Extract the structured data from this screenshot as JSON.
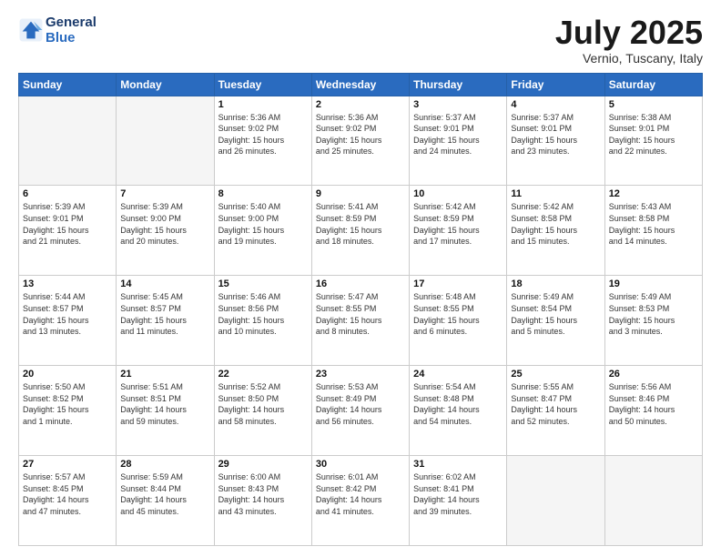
{
  "header": {
    "logo_line1": "General",
    "logo_line2": "Blue",
    "month_year": "July 2025",
    "location": "Vernio, Tuscany, Italy"
  },
  "days_of_week": [
    "Sunday",
    "Monday",
    "Tuesday",
    "Wednesday",
    "Thursday",
    "Friday",
    "Saturday"
  ],
  "weeks": [
    [
      {
        "day": "",
        "info": ""
      },
      {
        "day": "",
        "info": ""
      },
      {
        "day": "1",
        "info": "Sunrise: 5:36 AM\nSunset: 9:02 PM\nDaylight: 15 hours\nand 26 minutes."
      },
      {
        "day": "2",
        "info": "Sunrise: 5:36 AM\nSunset: 9:02 PM\nDaylight: 15 hours\nand 25 minutes."
      },
      {
        "day": "3",
        "info": "Sunrise: 5:37 AM\nSunset: 9:01 PM\nDaylight: 15 hours\nand 24 minutes."
      },
      {
        "day": "4",
        "info": "Sunrise: 5:37 AM\nSunset: 9:01 PM\nDaylight: 15 hours\nand 23 minutes."
      },
      {
        "day": "5",
        "info": "Sunrise: 5:38 AM\nSunset: 9:01 PM\nDaylight: 15 hours\nand 22 minutes."
      }
    ],
    [
      {
        "day": "6",
        "info": "Sunrise: 5:39 AM\nSunset: 9:01 PM\nDaylight: 15 hours\nand 21 minutes."
      },
      {
        "day": "7",
        "info": "Sunrise: 5:39 AM\nSunset: 9:00 PM\nDaylight: 15 hours\nand 20 minutes."
      },
      {
        "day": "8",
        "info": "Sunrise: 5:40 AM\nSunset: 9:00 PM\nDaylight: 15 hours\nand 19 minutes."
      },
      {
        "day": "9",
        "info": "Sunrise: 5:41 AM\nSunset: 8:59 PM\nDaylight: 15 hours\nand 18 minutes."
      },
      {
        "day": "10",
        "info": "Sunrise: 5:42 AM\nSunset: 8:59 PM\nDaylight: 15 hours\nand 17 minutes."
      },
      {
        "day": "11",
        "info": "Sunrise: 5:42 AM\nSunset: 8:58 PM\nDaylight: 15 hours\nand 15 minutes."
      },
      {
        "day": "12",
        "info": "Sunrise: 5:43 AM\nSunset: 8:58 PM\nDaylight: 15 hours\nand 14 minutes."
      }
    ],
    [
      {
        "day": "13",
        "info": "Sunrise: 5:44 AM\nSunset: 8:57 PM\nDaylight: 15 hours\nand 13 minutes."
      },
      {
        "day": "14",
        "info": "Sunrise: 5:45 AM\nSunset: 8:57 PM\nDaylight: 15 hours\nand 11 minutes."
      },
      {
        "day": "15",
        "info": "Sunrise: 5:46 AM\nSunset: 8:56 PM\nDaylight: 15 hours\nand 10 minutes."
      },
      {
        "day": "16",
        "info": "Sunrise: 5:47 AM\nSunset: 8:55 PM\nDaylight: 15 hours\nand 8 minutes."
      },
      {
        "day": "17",
        "info": "Sunrise: 5:48 AM\nSunset: 8:55 PM\nDaylight: 15 hours\nand 6 minutes."
      },
      {
        "day": "18",
        "info": "Sunrise: 5:49 AM\nSunset: 8:54 PM\nDaylight: 15 hours\nand 5 minutes."
      },
      {
        "day": "19",
        "info": "Sunrise: 5:49 AM\nSunset: 8:53 PM\nDaylight: 15 hours\nand 3 minutes."
      }
    ],
    [
      {
        "day": "20",
        "info": "Sunrise: 5:50 AM\nSunset: 8:52 PM\nDaylight: 15 hours\nand 1 minute."
      },
      {
        "day": "21",
        "info": "Sunrise: 5:51 AM\nSunset: 8:51 PM\nDaylight: 14 hours\nand 59 minutes."
      },
      {
        "day": "22",
        "info": "Sunrise: 5:52 AM\nSunset: 8:50 PM\nDaylight: 14 hours\nand 58 minutes."
      },
      {
        "day": "23",
        "info": "Sunrise: 5:53 AM\nSunset: 8:49 PM\nDaylight: 14 hours\nand 56 minutes."
      },
      {
        "day": "24",
        "info": "Sunrise: 5:54 AM\nSunset: 8:48 PM\nDaylight: 14 hours\nand 54 minutes."
      },
      {
        "day": "25",
        "info": "Sunrise: 5:55 AM\nSunset: 8:47 PM\nDaylight: 14 hours\nand 52 minutes."
      },
      {
        "day": "26",
        "info": "Sunrise: 5:56 AM\nSunset: 8:46 PM\nDaylight: 14 hours\nand 50 minutes."
      }
    ],
    [
      {
        "day": "27",
        "info": "Sunrise: 5:57 AM\nSunset: 8:45 PM\nDaylight: 14 hours\nand 47 minutes."
      },
      {
        "day": "28",
        "info": "Sunrise: 5:59 AM\nSunset: 8:44 PM\nDaylight: 14 hours\nand 45 minutes."
      },
      {
        "day": "29",
        "info": "Sunrise: 6:00 AM\nSunset: 8:43 PM\nDaylight: 14 hours\nand 43 minutes."
      },
      {
        "day": "30",
        "info": "Sunrise: 6:01 AM\nSunset: 8:42 PM\nDaylight: 14 hours\nand 41 minutes."
      },
      {
        "day": "31",
        "info": "Sunrise: 6:02 AM\nSunset: 8:41 PM\nDaylight: 14 hours\nand 39 minutes."
      },
      {
        "day": "",
        "info": ""
      },
      {
        "day": "",
        "info": ""
      }
    ]
  ]
}
